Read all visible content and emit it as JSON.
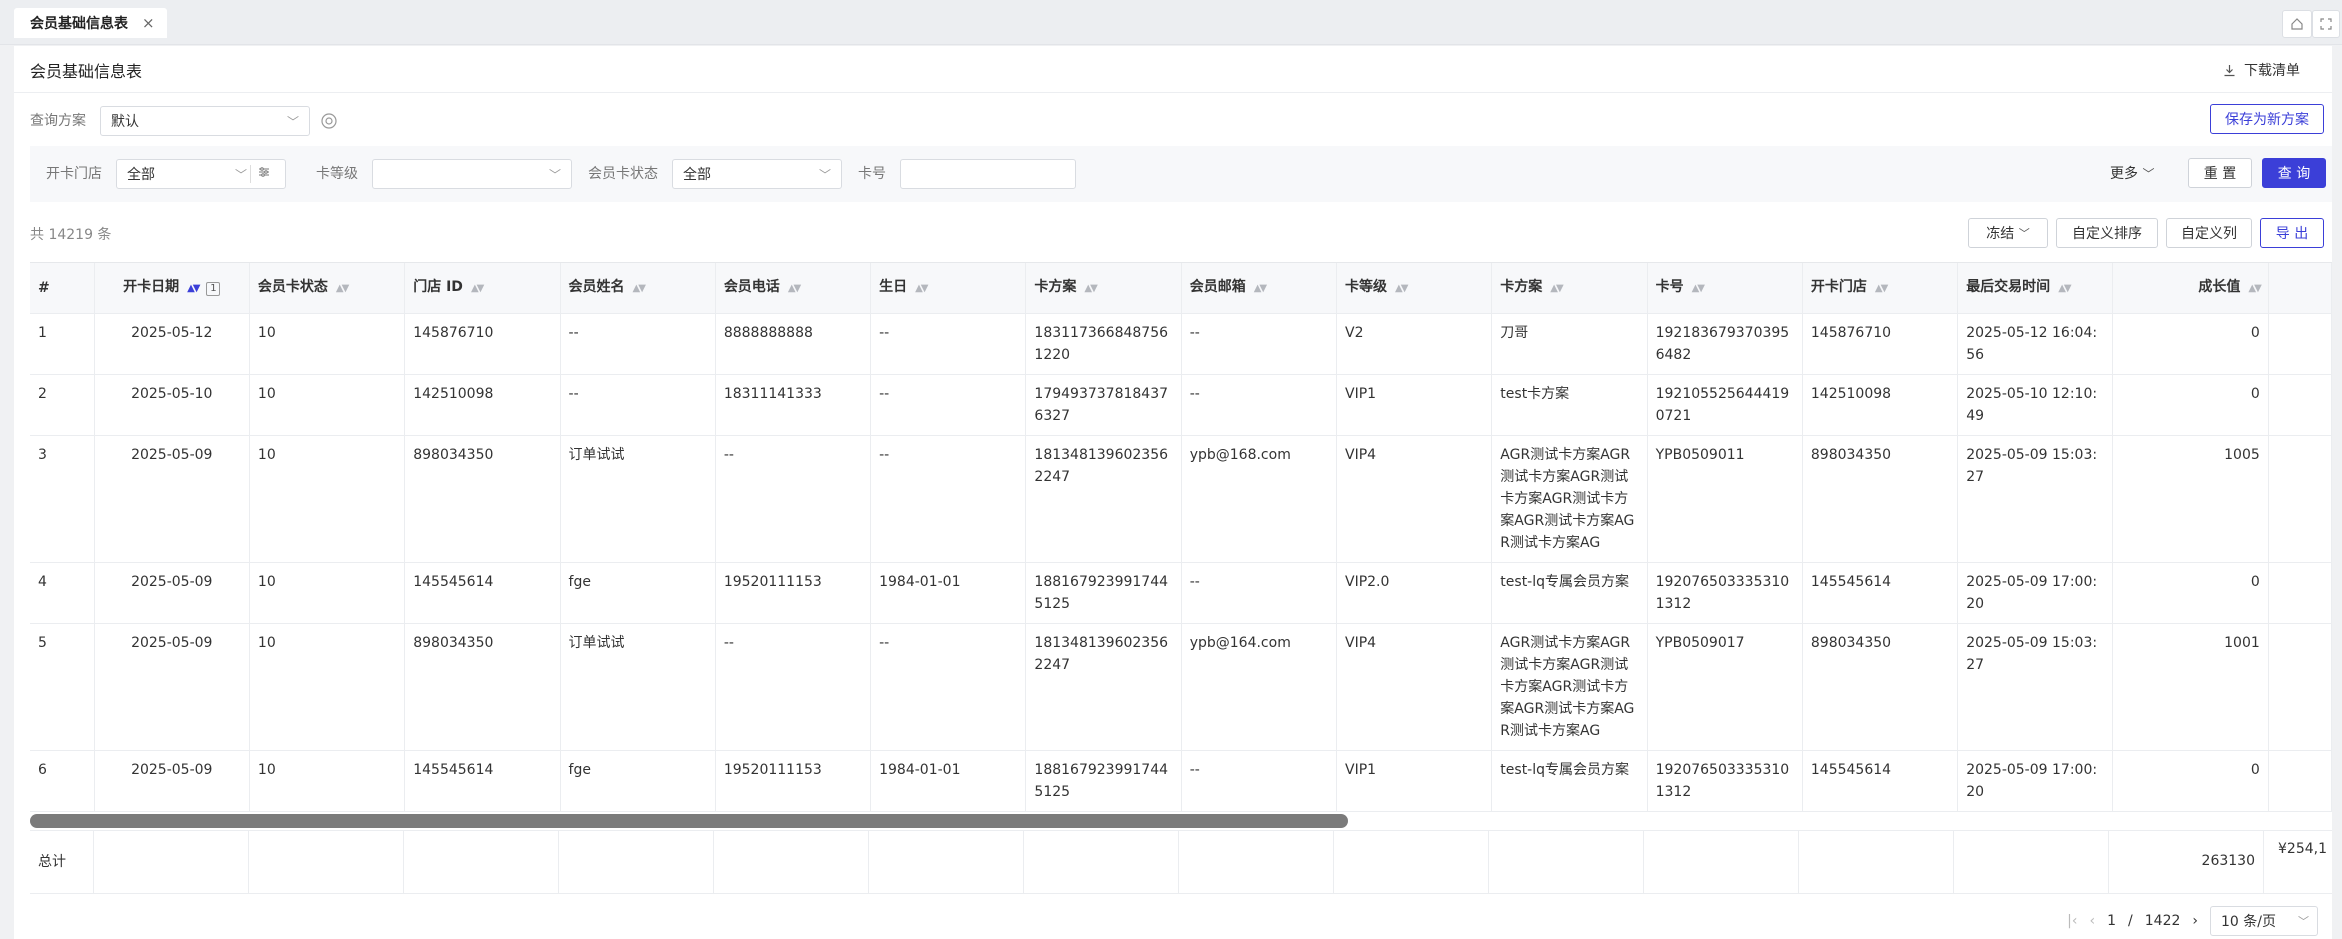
{
  "tabbar": {
    "tab_label": "会员基础信息表",
    "close_glyph": "×"
  },
  "panel": {
    "title": "会员基础信息表",
    "download_label": "下载清单"
  },
  "query": {
    "label": "查询方案",
    "value": "默认",
    "save_label": "保存为新方案"
  },
  "filters": {
    "store_label": "开卡门店",
    "store_value": "全部",
    "level_label": "卡等级",
    "level_value": "",
    "status_label": "会员卡状态",
    "status_value": "全部",
    "card_label": "卡号",
    "card_value": "",
    "more_label": "更多",
    "reset_label": "重 置",
    "search_label": "查 询"
  },
  "toolbar": {
    "count_text": "共 14219 条",
    "freeze_label": "冻结",
    "custom_sort_label": "自定义排序",
    "custom_col_label": "自定义列",
    "export_label": "导 出"
  },
  "table": {
    "columns": [
      "#",
      "开卡日期",
      "会员卡状态",
      "门店 ID",
      "会员姓名",
      "会员电话",
      "生日",
      "卡方案",
      "会员邮箱",
      "卡等级",
      "卡方案",
      "卡号",
      "开卡门店",
      "最后交易时间",
      "成长值"
    ],
    "sort_badge": "1",
    "rows": [
      [
        "1",
        "2025-05-12",
        "10",
        "145876710",
        "--",
        "8888888888",
        "--",
        "1831173668487561220",
        "--",
        "V2",
        "刀哥",
        "1921836793703956482",
        "145876710",
        "2025-05-12 16:04:56",
        "0"
      ],
      [
        "2",
        "2025-05-10",
        "10",
        "142510098",
        "--",
        "18311141333",
        "--",
        "1794937378184376327",
        "--",
        "VIP1",
        "test卡方案",
        "1921055256444190721",
        "142510098",
        "2025-05-10 12:10:49",
        "0"
      ],
      [
        "3",
        "2025-05-09",
        "10",
        "898034350",
        "订单试试",
        "--",
        "--",
        "1813481396023562247",
        "ypb@168.com",
        "VIP4",
        "AGR测试卡方案AGR测试卡方案AGR测试卡方案AGR测试卡方案AGR测试卡方案AGR测试卡方案AG",
        "YPB0509011",
        "898034350",
        "2025-05-09 15:03:27",
        "1005"
      ],
      [
        "4",
        "2025-05-09",
        "10",
        "145545614",
        "fge",
        "19520111153",
        "1984-01-01",
        "1881679239917445125",
        "--",
        "VIP2.0",
        "test-lq专属会员方案",
        "1920765033353101312",
        "145545614",
        "2025-05-09 17:00:20",
        "0"
      ],
      [
        "5",
        "2025-05-09",
        "10",
        "898034350",
        "订单试试",
        "--",
        "--",
        "1813481396023562247",
        "ypb@164.com",
        "VIP4",
        "AGR测试卡方案AGR测试卡方案AGR测试卡方案AGR测试卡方案AGR测试卡方案AGR测试卡方案AG",
        "YPB0509017",
        "898034350",
        "2025-05-09 15:03:27",
        "1001"
      ],
      [
        "6",
        "2025-05-09",
        "10",
        "145545614",
        "fge",
        "19520111153",
        "1984-01-01",
        "1881679239917445125",
        "--",
        "VIP1",
        "test-lq专属会员方案",
        "1920765033353101312",
        "145545614",
        "2025-05-09 17:00:20",
        "0"
      ]
    ],
    "total_label": "总计",
    "total_growth": "263130",
    "total_amount": "¥254,1"
  },
  "pager": {
    "current": "1",
    "separator": "/",
    "total": "1422",
    "page_size": "10 条/页"
  },
  "colors": {
    "primary": "#3b3fd8"
  }
}
